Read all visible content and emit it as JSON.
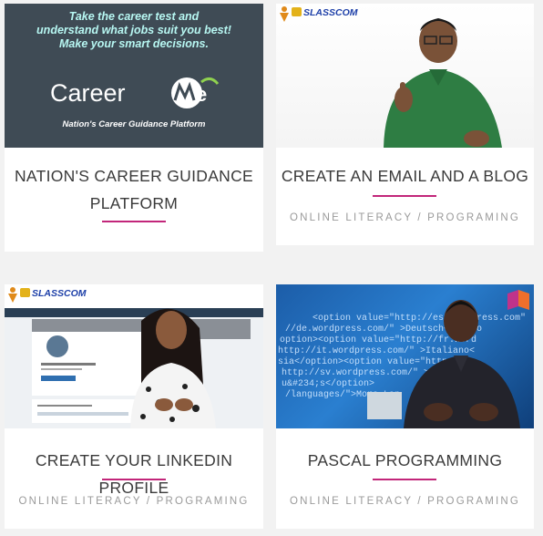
{
  "cards": [
    {
      "title": "NATION'S CAREER GUIDANCE PLATFORM",
      "category": "",
      "thumbnail": {
        "lines": [
          "Take the career test and",
          "understand what jobs suit you best!",
          "Make your smart decisions."
        ],
        "brand": "CareerMe",
        "brand_mark": "®",
        "tagline": "Nation's Career Guidance Platform"
      }
    },
    {
      "title": "CREATE AN EMAIL AND A BLOG",
      "category": "ONLINE LITERACY / PROGRAMING",
      "thumbnail": {
        "logo": "SLASSCOM"
      }
    },
    {
      "title": "CREATE YOUR LINKEDIN PROFILE",
      "category": "ONLINE LITERACY / PROGRAMING",
      "thumbnail": {
        "logo": "SLASSCOM"
      }
    },
    {
      "title": "PASCAL PROGRAMMING",
      "category": "ONLINE LITERACY / PROGRAMING",
      "thumbnail": {
        "code_lines": [
          "<option value=\"http://es.wordpress.com\"",
          "//de.wordpress.com/\" >Deutsch</optio",
          "option><option value=\"http://fr.word",
          "http://it.wordpress.com/\" >Italiano<",
          "sia</option><option value=\"http://",
          "http://sv.wordpress.com/\" >Svensk",
          "u&#234;s</option>",
          "/languages/\">More Lan"
        ]
      }
    }
  ],
  "colors": {
    "accent": "#c2267a",
    "page_bg": "#f2f2f2",
    "card_bg": "#ffffff"
  }
}
